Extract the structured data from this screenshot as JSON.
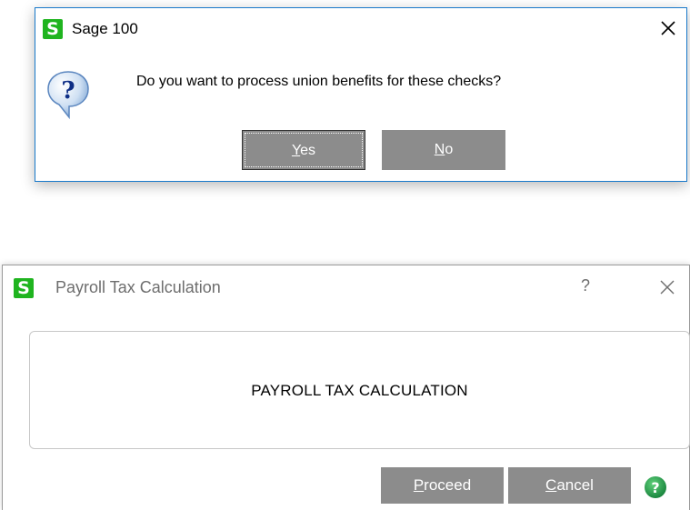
{
  "dialog1": {
    "title": "Sage 100",
    "logo_letter": "S",
    "message": "Do you want to process union benefits for these checks?",
    "icon": "question-icon",
    "yes": {
      "mnemonic": "Y",
      "rest": "es"
    },
    "no": {
      "mnemonic": "N",
      "rest": "o"
    }
  },
  "dialog2": {
    "title": "Payroll Tax Calculation",
    "logo_letter": "S",
    "help_glyph": "?",
    "panel_text": "PAYROLL TAX CALCULATION",
    "proceed": {
      "mnemonic": "P",
      "rest": "roceed"
    },
    "cancel": {
      "mnemonic": "C",
      "rest": "ancel"
    },
    "help_icon": "help-circle-icon"
  },
  "colors": {
    "logo_green": "#1fb41f",
    "button_gray": "#8c8c8c",
    "dialog1_border": "#1979ca",
    "help_green": "#1a9e3c"
  }
}
